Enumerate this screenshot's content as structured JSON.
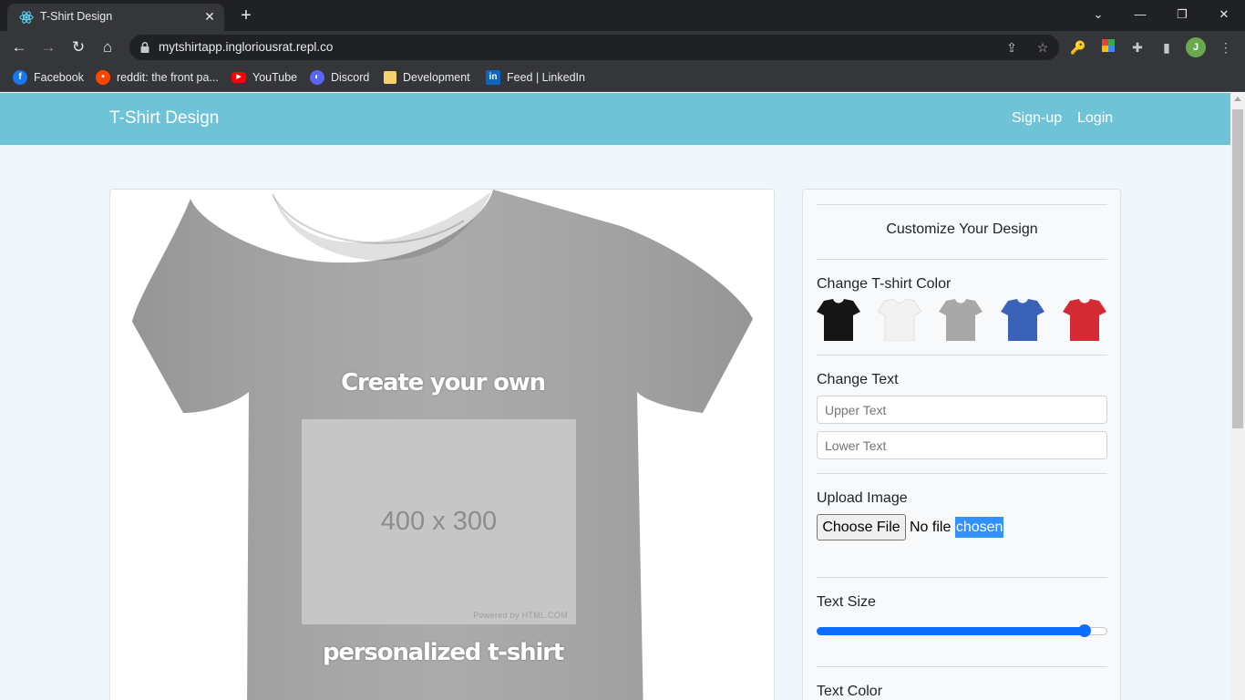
{
  "browser": {
    "tab_title": "T-Shirt Design",
    "url": "mytshirtapp.ingloriousrat.repl.co",
    "profile_initial": "J",
    "bookmarks": [
      "Facebook",
      "reddit: the front pa...",
      "YouTube",
      "Discord",
      "Development",
      "Feed | LinkedIn"
    ]
  },
  "navbar": {
    "brand": "T-Shirt Design",
    "signup": "Sign-up",
    "login": "Login"
  },
  "preview": {
    "upper_text": "Create your own",
    "lower_text": "personalized t-shirt",
    "placeholder_size": "400 x 300",
    "placeholder_powered": "Powered by HTML.COM",
    "shirt_color": "#a6a6a6"
  },
  "panel": {
    "title": "Customize Your Design",
    "color_label": "Change T-shirt Color",
    "swatches": [
      {
        "name": "black",
        "color": "#151515"
      },
      {
        "name": "white",
        "color": "#f2f2f2"
      },
      {
        "name": "gray",
        "color": "#a8a8a8"
      },
      {
        "name": "blue",
        "color": "#3a62b8"
      },
      {
        "name": "red",
        "color": "#d42a33"
      }
    ],
    "text_label": "Change Text",
    "upper_placeholder": "Upper Text",
    "lower_placeholder": "Lower Text",
    "upload_label": "Upload Image",
    "choose_file": "Choose File",
    "no_file_1": "No file",
    "no_file_2": "chosen",
    "size_label": "Text Size",
    "size_value": 0.94,
    "color_text_label": "Text Color"
  }
}
